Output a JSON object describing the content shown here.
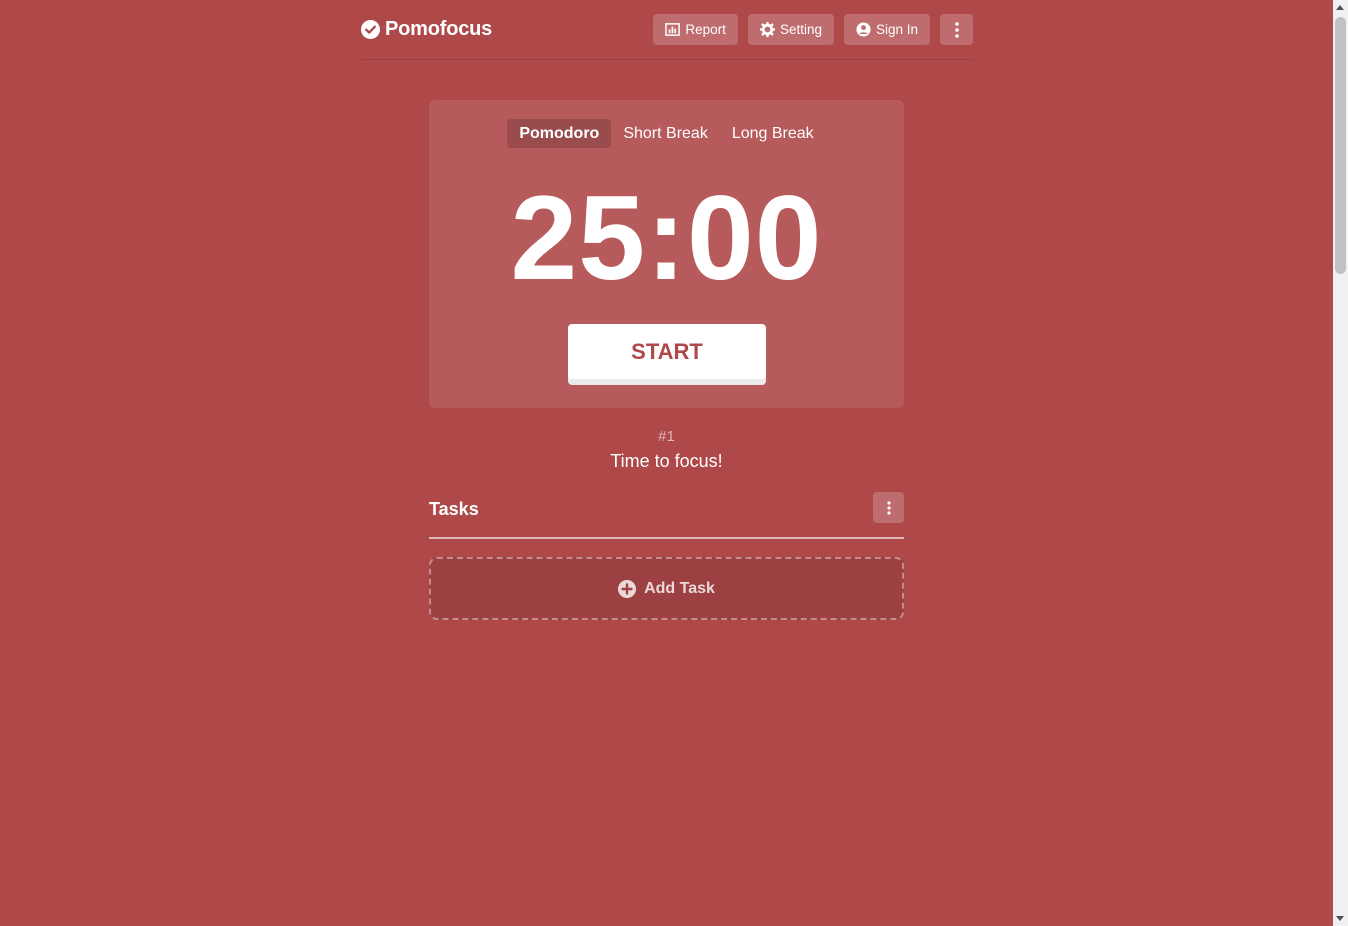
{
  "header": {
    "logo_text": "Pomofocus",
    "report_label": "Report",
    "setting_label": "Setting",
    "signin_label": "Sign In"
  },
  "timer": {
    "modes": [
      "Pomodoro",
      "Short Break",
      "Long Break"
    ],
    "active_mode": "Pomodoro",
    "time": "25:00",
    "start_label": "START"
  },
  "session": {
    "number": "#1",
    "message": "Time to focus!"
  },
  "tasks": {
    "title": "Tasks",
    "add_label": "Add Task"
  },
  "colors": {
    "background": "#ae4849",
    "accent": "#ae4849",
    "text": "#ffffff"
  }
}
